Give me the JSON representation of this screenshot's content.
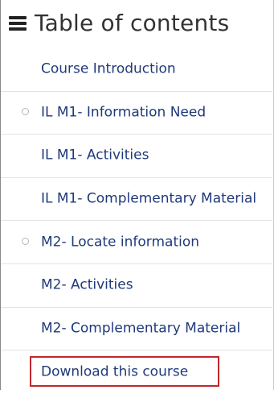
{
  "header": {
    "menu_icon": "hamburger-menu-icon",
    "title": "Table of contents"
  },
  "toc": {
    "items": [
      {
        "label": "Course Introduction",
        "bullet": false
      },
      {
        "label": "IL M1- Information Need",
        "bullet": true
      },
      {
        "label": "IL M1- Activities",
        "bullet": false
      },
      {
        "label": "IL M1- Complementary Material",
        "bullet": false
      },
      {
        "label": "M2- Locate information",
        "bullet": true
      },
      {
        "label": "M2- Activities",
        "bullet": false
      },
      {
        "label": "M2- Complementary Material",
        "bullet": false
      },
      {
        "label": "Download this course",
        "bullet": false,
        "highlighted": true
      }
    ]
  },
  "colors": {
    "link": "#1f3a7a",
    "title": "#333333",
    "highlight_border": "#c0282d"
  }
}
